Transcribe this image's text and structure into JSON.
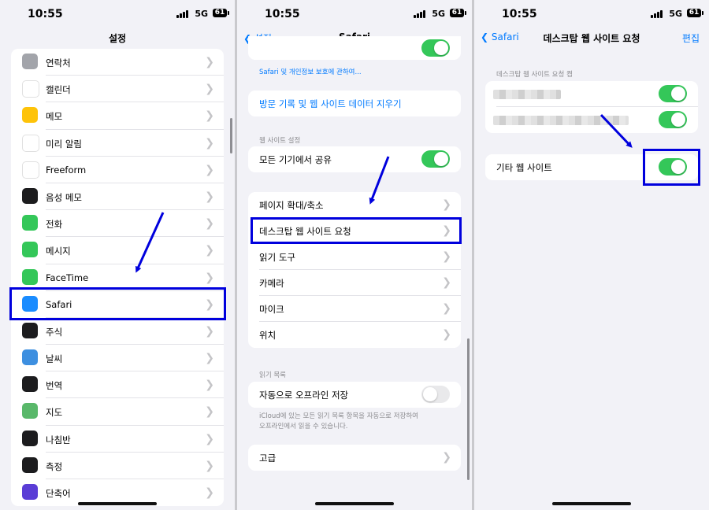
{
  "status": {
    "time": "10:55",
    "network": "5G",
    "battery": "61"
  },
  "panel1": {
    "title": "설정",
    "items": [
      {
        "label": "연락처",
        "icon": "contacts-icon",
        "color": "#a2a4aa"
      },
      {
        "label": "캘린더",
        "icon": "calendar-icon",
        "color": "#ffffff"
      },
      {
        "label": "메모",
        "icon": "notes-icon",
        "color": "#fec309"
      },
      {
        "label": "미리 알림",
        "icon": "reminders-icon",
        "color": "#ffffff"
      },
      {
        "label": "Freeform",
        "icon": "freeform-icon",
        "color": "#ffffff"
      },
      {
        "label": "음성 메모",
        "icon": "voice-memo-icon",
        "color": "#1c1c1e"
      },
      {
        "label": "전화",
        "icon": "phone-icon",
        "color": "#34c759"
      },
      {
        "label": "메시지",
        "icon": "messages-icon",
        "color": "#34c759"
      },
      {
        "label": "FaceTime",
        "icon": "facetime-icon",
        "color": "#34c759"
      },
      {
        "label": "Safari",
        "icon": "safari-icon",
        "color": "#1a8cff"
      },
      {
        "label": "주식",
        "icon": "stocks-icon",
        "color": "#1c1c1e"
      },
      {
        "label": "날씨",
        "icon": "weather-icon",
        "color": "#3d8fe0"
      },
      {
        "label": "번역",
        "icon": "translate-icon",
        "color": "#1c1c1e"
      },
      {
        "label": "지도",
        "icon": "maps-icon",
        "color": "#59b86a"
      },
      {
        "label": "나침반",
        "icon": "compass-icon",
        "color": "#1c1c1e"
      },
      {
        "label": "측정",
        "icon": "measure-icon",
        "color": "#1c1c1e"
      },
      {
        "label": "단축어",
        "icon": "shortcuts-icon",
        "color": "#5a3dd6"
      }
    ]
  },
  "panel2": {
    "back": "설정",
    "title": "Safari",
    "privacy_link": "Safari 및 개인정보 보호에 관하여...",
    "clear_history": "방문 기록 및 웹 사이트 데이터 지우기",
    "website_settings_header": "웹 사이트 설정",
    "share_across_devices": "모든 기기에서 공유",
    "settings_items": [
      "페이지 확대/축소",
      "데스크탑 웹 사이트 요청",
      "읽기 도구",
      "카메라",
      "마이크",
      "위치"
    ],
    "reading_list_header": "읽기 목록",
    "auto_save_offline": "자동으로 오프라인 저장",
    "reading_list_footer_1": "iCloud에 있는 모든 읽기 목록 항목을 자동으로 저장하여",
    "reading_list_footer_2": "오프라인에서 읽을 수 있습니다.",
    "advanced": "고급"
  },
  "panel3": {
    "back": "Safari",
    "title": "데스크탑 웹 사이트 요청",
    "edit": "편집",
    "section_header": "데스크탑 웹 사이트 요청 켬",
    "other_websites": "기타 웹 사이트"
  },
  "colors": {
    "accent": "#007aff",
    "toggle_on": "#34c759",
    "highlight": "#0000dd"
  }
}
